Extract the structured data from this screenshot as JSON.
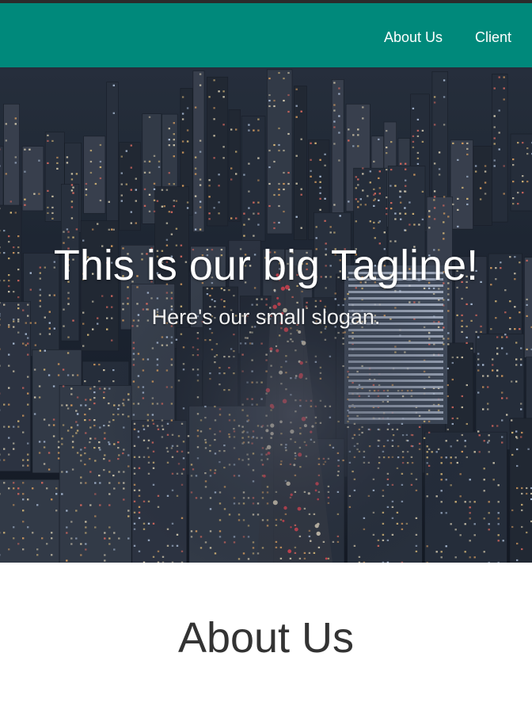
{
  "nav": {
    "links": [
      {
        "label": "About Us"
      },
      {
        "label": "Client"
      }
    ]
  },
  "hero": {
    "title": "This is our big Tagline!",
    "subtitle": "Here's our small slogan."
  },
  "about": {
    "heading": "About Us"
  },
  "colors": {
    "navbar": "#00897b",
    "top_strip": "#2b2b2b",
    "heading_text": "#333333",
    "hero_night": "#1b2330"
  }
}
